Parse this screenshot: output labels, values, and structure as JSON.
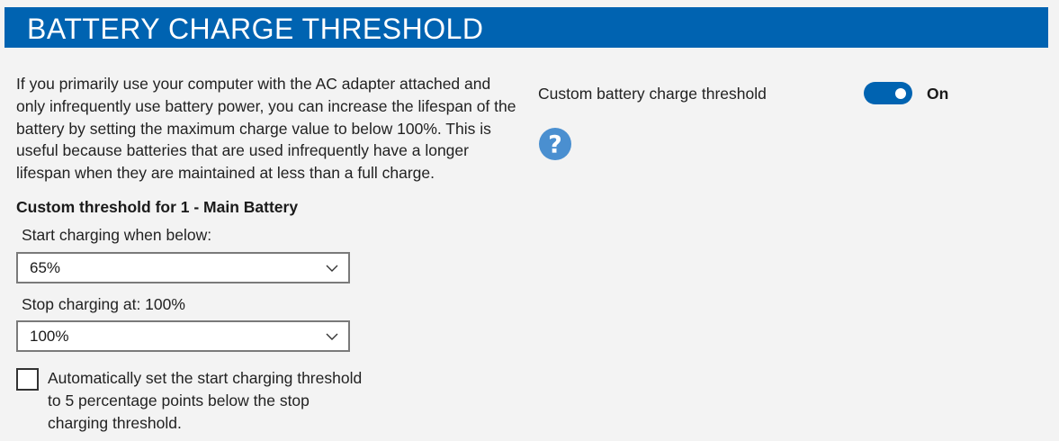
{
  "header": {
    "title": "BATTERY CHARGE THRESHOLD"
  },
  "description": "If you primarily use your computer with the AC adapter attached and only infrequently use battery power, you can increase the lifespan of the battery by setting the maximum charge value to below 100%. This is useful because batteries that are used infrequently have a longer lifespan when they are maintained at less than a full charge.",
  "threshold": {
    "section_title": "Custom threshold for 1 - Main Battery",
    "start": {
      "label": "Start charging when below:",
      "value": "65%"
    },
    "stop": {
      "label": "Stop charging at: 100%",
      "value": "100%"
    },
    "auto_checkbox": {
      "label": "Automatically set the start charging threshold to 5 percentage points below the stop charging threshold.",
      "checked": false
    }
  },
  "custom_toggle": {
    "label": "Custom battery charge threshold",
    "state": "On",
    "on": true
  },
  "help": {
    "icon": "question-circle-icon"
  },
  "colors": {
    "accent": "#0063b1",
    "background": "#f3f3f3",
    "help_icon": "#4a8fd0"
  }
}
